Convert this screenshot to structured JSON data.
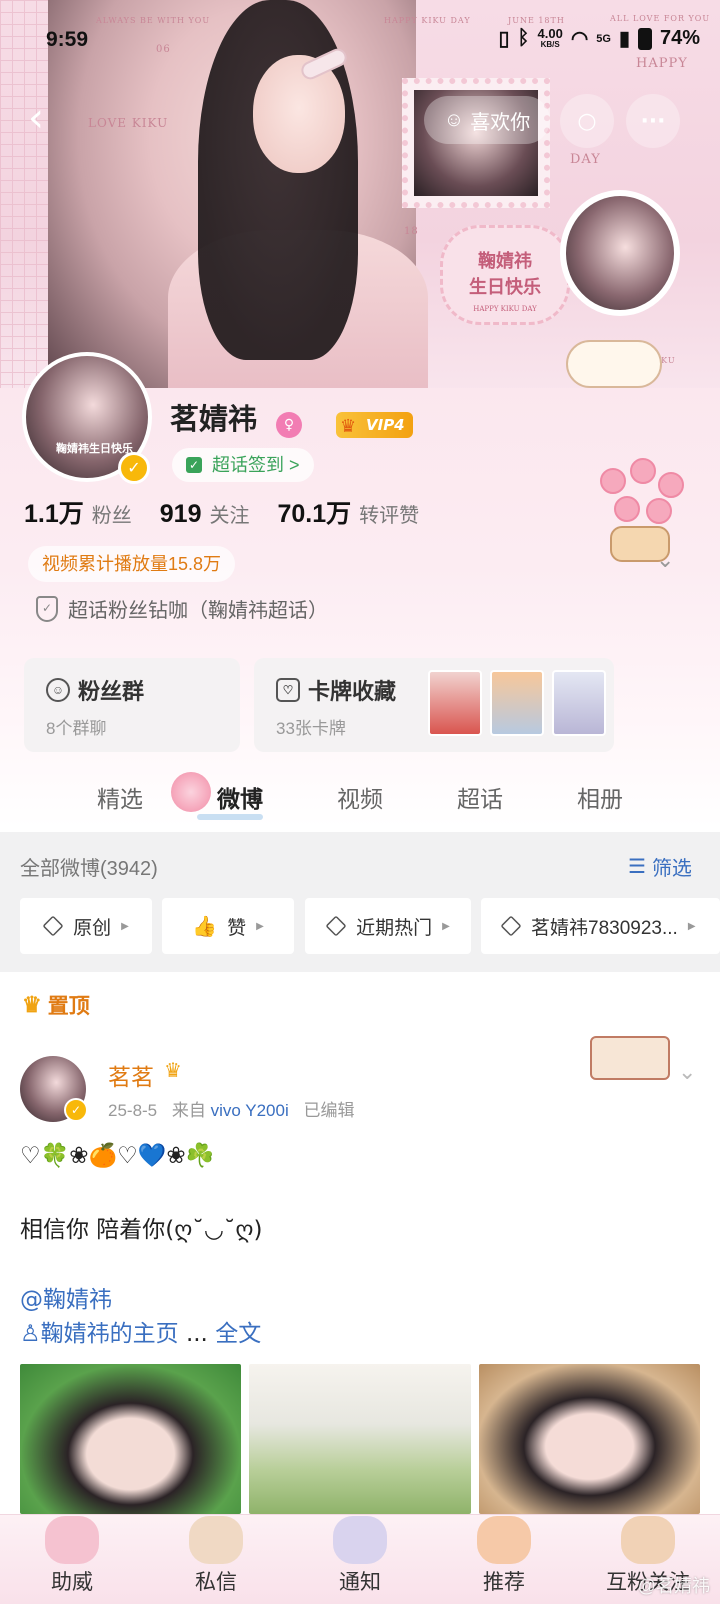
{
  "status_bar": {
    "time": "9:59",
    "speed_value": "4.00",
    "speed_unit": "KB/S",
    "signal_label": "5G",
    "battery": "74%"
  },
  "banner": {
    "deco_always": "ALWAYS BE WITH YOU",
    "deco_love": "LOVE KIKU",
    "deco_happy_kiku": "HAPPY KIKU DAY",
    "deco_june": "JUNE 18TH",
    "deco_all_love": "ALL LOVE FOR YOU",
    "deco_happy": "HAPPY",
    "deco_day": "DAY",
    "deco_06": "06",
    "deco_18": "18",
    "heart_line1": "鞠婧祎",
    "heart_line2": "生日快乐",
    "heart_small": "HAPPY KIKU DAY",
    "deco_kiku": "KIKU"
  },
  "actions": {
    "like_label": "喜欢你",
    "more_label": "···"
  },
  "profile": {
    "avatar_label": "鞠婧祎生日快乐",
    "name": "茗婧祎",
    "vip_label": "VIP4",
    "checkin_label": "超话签到",
    "checkin_arrow": ">",
    "stats": [
      {
        "value": "1.1万",
        "label": "粉丝"
      },
      {
        "value": "919",
        "label": "关注"
      },
      {
        "value": "70.1万",
        "label": "转评赞"
      }
    ],
    "video_plays": "视频累计播放量15.8万",
    "fan_rank": "超话粉丝钻咖（鞠婧祎超话）"
  },
  "cards": {
    "fan_group": {
      "title": "粉丝群",
      "sub": "8个群聊"
    },
    "card_collection": {
      "title": "卡牌收藏",
      "sub": "33张卡牌"
    }
  },
  "tabs": [
    "精选",
    "微博",
    "视频",
    "超话",
    "相册"
  ],
  "filter": {
    "all_label": "全部微博(3942)",
    "filter_label": "筛选",
    "chips": [
      "原创",
      "赞",
      "近期热门",
      "茗婧祎7830923..."
    ]
  },
  "pinned_label": "置顶",
  "post": {
    "author": "茗茗",
    "date": "25-8-5",
    "source_prefix": "来自",
    "source": "vivo Y200i",
    "edited": "已编辑",
    "line1": "♡🍀❀🍊♡💙❀☘️",
    "line2": "相信你 陪着你(ღ˘◡˘ღ)",
    "mention": "@鞠婧祎",
    "home_link": "鞠婧祎的主页",
    "ellipsis": "...",
    "full_text": "全文"
  },
  "bottom_nav": [
    "助威",
    "私信",
    "通知",
    "推荐",
    "互粉关注"
  ],
  "watermark": "@茗婧祎",
  "colors": {
    "accent_orange": "#e07b13",
    "link_blue": "#3a6fc0",
    "vip_gold": "#f9c23a",
    "checkin_green": "#3aa35a"
  }
}
